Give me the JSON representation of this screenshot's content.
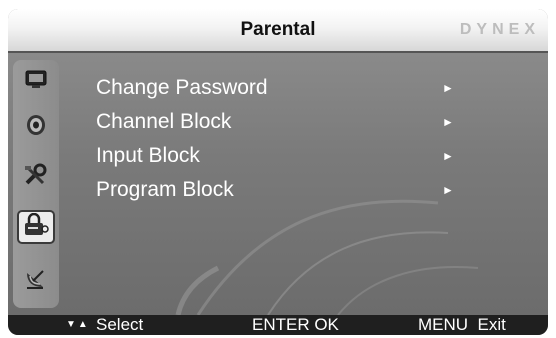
{
  "header": {
    "title": "Parental",
    "brand": "DYNEX"
  },
  "sidebar": {
    "items": [
      {
        "icon": "tv-picture-icon",
        "selected": false
      },
      {
        "icon": "audio-speaker-icon",
        "selected": false
      },
      {
        "icon": "tools-settings-icon",
        "selected": false
      },
      {
        "icon": "padlock-icon",
        "selected": true
      },
      {
        "icon": "satellite-dish-icon",
        "selected": false
      }
    ]
  },
  "menu": {
    "items": [
      {
        "label": "Change Password",
        "arrow": "►"
      },
      {
        "label": "Channel Block",
        "arrow": "►"
      },
      {
        "label": "Input Block",
        "arrow": "►"
      },
      {
        "label": "Program Block",
        "arrow": "►"
      }
    ]
  },
  "footer": {
    "nav_arrows": "▼▲",
    "select_label": "Select",
    "enter_label": "ENTER OK",
    "menu_label": "MENU  Exit"
  },
  "colors": {
    "title_bar": "#f3f3f3",
    "content_bg": "#7a7a7a",
    "footer_bg": "#1f1f1f",
    "brand_text": "#bdbdbd"
  }
}
